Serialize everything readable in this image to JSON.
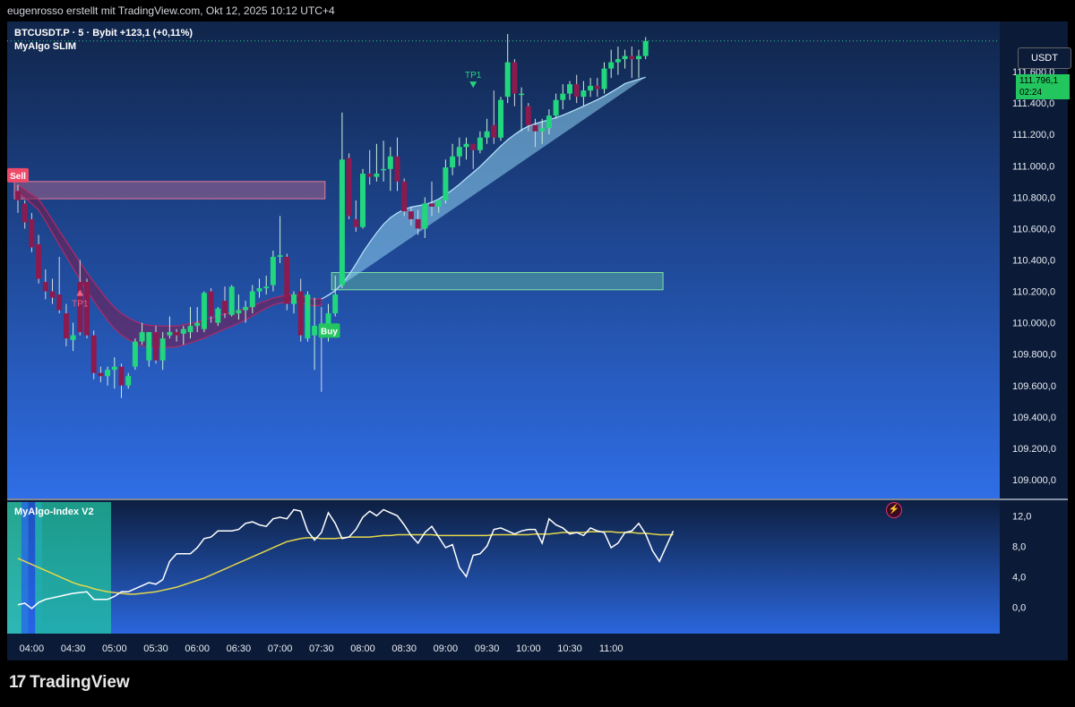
{
  "header": {
    "text": "eugenrosso erstellt mit TradingView.com, Okt 12, 2025 10:12 UTC+4"
  },
  "legend": {
    "symbol_line": "BTCUSDT.P · 5 · Bybit  +123,1 (+0,11%)",
    "indicator": "MyAlgo SLIM",
    "sub_indicator": "MyAlgo-Index V2"
  },
  "price_scale": {
    "currency": "USDT",
    "last_price": "111.796,1",
    "countdown": "02:24"
  },
  "footer": {
    "brand": "TradingView"
  },
  "signals": {
    "sell": "Sell",
    "buy": "Buy",
    "tp1_red": "TP1",
    "tp1_green": "TP1"
  },
  "colors": {
    "bull": "#22d67e",
    "bear": "#8b1a4f",
    "band_bull": "#8fd3f4",
    "band_bear": "#7a1a4a",
    "osc_line": "#ffffff",
    "signal_line": "#e6d84a"
  },
  "chart_data": [
    {
      "type": "candlestick",
      "symbol": "BTCUSDT.P",
      "interval": "5",
      "exchange": "Bybit",
      "x_ticks": [
        "04:00",
        "04:30",
        "05:00",
        "05:30",
        "06:00",
        "06:30",
        "07:00",
        "07:30",
        "08:00",
        "08:30",
        "09:00",
        "09:30",
        "10:00",
        "10:30",
        "11:00"
      ],
      "y_ticks": [
        "111.600,0",
        "111.400,0",
        "111.200,0",
        "111.000,0",
        "110.800,0",
        "110.600,0",
        "110.400,0",
        "110.200,0",
        "110.000,0",
        "109.800,0",
        "109.600,0",
        "109.400,0",
        "109.200,0",
        "109.000,0"
      ],
      "ylim": [
        108880,
        111920
      ],
      "x_start": "03:50",
      "candles": [
        [
          110840,
          110880,
          110700,
          110780
        ],
        [
          110760,
          110780,
          110600,
          110640
        ],
        [
          110660,
          110700,
          110450,
          110480
        ],
        [
          110500,
          110560,
          110250,
          110280
        ],
        [
          110260,
          110340,
          110150,
          110200
        ],
        [
          110200,
          110280,
          110120,
          110160
        ],
        [
          110180,
          110420,
          110060,
          110080
        ],
        [
          110060,
          110120,
          109850,
          109900
        ],
        [
          109890,
          110000,
          109820,
          109920
        ],
        [
          110260,
          110400,
          109920,
          109940
        ],
        [
          110260,
          110280,
          109900,
          109920
        ],
        [
          109920,
          109950,
          109640,
          109680
        ],
        [
          109680,
          109720,
          109620,
          109660
        ],
        [
          109660,
          109720,
          109600,
          109700
        ],
        [
          109700,
          109780,
          109580,
          109720
        ],
        [
          109720,
          109740,
          109520,
          109600
        ],
        [
          109600,
          109680,
          109580,
          109660
        ],
        [
          109720,
          109900,
          109700,
          109880
        ],
        [
          109880,
          110000,
          109860,
          109940
        ],
        [
          109760,
          109940,
          109720,
          109940
        ],
        [
          109940,
          109980,
          109740,
          109760
        ],
        [
          109760,
          109940,
          109700,
          109900
        ],
        [
          109920,
          110040,
          109900,
          109940
        ],
        [
          109940,
          109960,
          109880,
          109920
        ],
        [
          109930,
          109980,
          109860,
          109960
        ],
        [
          109940,
          110100,
          109900,
          109980
        ],
        [
          109980,
          110100,
          109940,
          110000
        ],
        [
          109960,
          110200,
          109940,
          110190
        ],
        [
          110200,
          110220,
          110000,
          110040
        ],
        [
          110000,
          110100,
          109980,
          110090
        ],
        [
          110140,
          110230,
          110030,
          110060
        ],
        [
          110050,
          110240,
          110040,
          110230
        ],
        [
          110060,
          110180,
          110020,
          110080
        ],
        [
          110080,
          110140,
          110000,
          110100
        ],
        [
          110100,
          110240,
          110060,
          110200
        ],
        [
          110200,
          110280,
          110160,
          110220
        ],
        [
          110220,
          110300,
          110180,
          110230
        ],
        [
          110240,
          110460,
          110200,
          110420
        ],
        [
          110420,
          110680,
          110380,
          110430
        ],
        [
          110420,
          110440,
          110080,
          110120
        ],
        [
          110120,
          110200,
          110060,
          110180
        ],
        [
          110200,
          110280,
          109880,
          109920
        ],
        [
          109900,
          110200,
          109880,
          110180
        ],
        [
          109920,
          110160,
          109700,
          109980
        ],
        [
          109980,
          110100,
          109560,
          109920
        ],
        [
          109920,
          110120,
          109880,
          110060
        ],
        [
          110060,
          110300,
          110040,
          110180
        ],
        [
          110240,
          111340,
          110220,
          111040
        ],
        [
          111050,
          111080,
          110660,
          110680
        ],
        [
          110660,
          110780,
          110580,
          110610
        ],
        [
          110610,
          110980,
          110600,
          110950
        ],
        [
          110950,
          111100,
          110880,
          110930
        ],
        [
          110930,
          111140,
          110900,
          110950
        ],
        [
          110980,
          111160,
          110900,
          110980
        ],
        [
          110980,
          111120,
          110840,
          111060
        ],
        [
          111060,
          111180,
          110840,
          110900
        ],
        [
          110900,
          110920,
          110680,
          110710
        ],
        [
          110710,
          110740,
          110620,
          110660
        ],
        [
          110660,
          110720,
          110560,
          110600
        ],
        [
          110600,
          110800,
          110540,
          110760
        ],
        [
          110760,
          110900,
          110680,
          110740
        ],
        [
          110740,
          110780,
          110700,
          110780
        ],
        [
          110780,
          111040,
          110760,
          110990
        ],
        [
          110990,
          111140,
          110940,
          111060
        ],
        [
          111060,
          111180,
          111000,
          111120
        ],
        [
          111120,
          111180,
          111040,
          111140
        ],
        [
          111140,
          111120,
          110980,
          111100
        ],
        [
          111100,
          111220,
          111080,
          111180
        ],
        [
          111180,
          111300,
          111140,
          111220
        ],
        [
          111260,
          111480,
          111140,
          111180
        ],
        [
          111180,
          111440,
          111160,
          111420
        ],
        [
          111440,
          111840,
          111400,
          111660
        ],
        [
          111660,
          111680,
          111380,
          111460
        ],
        [
          111460,
          111500,
          111220,
          111460
        ],
        [
          111380,
          111400,
          111220,
          111260
        ],
        [
          111260,
          111300,
          111120,
          111220
        ],
        [
          111220,
          111300,
          111140,
          111240
        ],
        [
          111240,
          111360,
          111200,
          111320
        ],
        [
          111320,
          111460,
          111300,
          111420
        ],
        [
          111420,
          111520,
          111360,
          111460
        ],
        [
          111460,
          111540,
          111420,
          111520
        ],
        [
          111520,
          111580,
          111400,
          111440
        ],
        [
          111440,
          111540,
          111380,
          111480
        ],
        [
          111480,
          111560,
          111440,
          111510
        ],
        [
          111510,
          111560,
          111440,
          111490
        ],
        [
          111490,
          111660,
          111460,
          111620
        ],
        [
          111620,
          111740,
          111560,
          111660
        ],
        [
          111660,
          111760,
          111580,
          111680
        ],
        [
          111680,
          111740,
          111620,
          111700
        ],
        [
          111700,
          111760,
          111560,
          111680
        ],
        [
          111680,
          111740,
          111560,
          111700
        ],
        [
          111700,
          111820,
          111680,
          111796
        ]
      ],
      "band": {
        "bear_segment": {
          "from_index": 0,
          "to_index": 44
        },
        "bull_segment": {
          "from_index": 44,
          "to_index": 93
        }
      },
      "zones": [
        {
          "type": "supply",
          "from_index": 0,
          "to_index": 44,
          "low": 110790,
          "high": 110900
        },
        {
          "type": "demand",
          "from_index": 46,
          "to_index": 93,
          "low": 110210,
          "high": 110320
        }
      ],
      "annotations": [
        {
          "label": "Sell",
          "index": 0,
          "price": 110940
        },
        {
          "label": "TP1",
          "index": 9,
          "price": 110160
        },
        {
          "label": "Buy",
          "index": 45,
          "price": 109950
        },
        {
          "label": "TP1",
          "index": 66,
          "price": 111480
        }
      ]
    },
    {
      "type": "line",
      "title": "MyAlgo-Index V2",
      "y_ticks": [
        "12,0",
        "8,0",
        "4,0",
        "0,0"
      ],
      "ylim": [
        -3.5,
        13.8
      ],
      "series": [
        {
          "values": [
            0.3,
            0.5,
            -0.2,
            0.6,
            1.0,
            1.2,
            1.4,
            1.6,
            1.8,
            1.9,
            2.0,
            1.0,
            1.0,
            1.0,
            1.4,
            2.0,
            2.0,
            2.4,
            2.8,
            3.2,
            3.0,
            3.6,
            6.0,
            7.0,
            7.0,
            7.0,
            7.8,
            9.0,
            9.2,
            10.0,
            10.0,
            10.0,
            10.2,
            11.0,
            11.2,
            10.8,
            10.6,
            11.6,
            11.8,
            11.6,
            12.8,
            12.6,
            10.0,
            8.8,
            9.8,
            12.4,
            11.0,
            9.0,
            9.2,
            10.2,
            11.8,
            12.6,
            12.0,
            12.8,
            12.4,
            12.0,
            10.8,
            9.4,
            8.4,
            9.8,
            10.6,
            9.2,
            7.8,
            8.2,
            5.2,
            4.0,
            6.8,
            7.0,
            8.0,
            10.2,
            10.4,
            10.0,
            9.6,
            10.0,
            10.2,
            10.2,
            8.4,
            11.6,
            10.8,
            10.4,
            9.6,
            9.8,
            9.4,
            10.4,
            10.0,
            9.8,
            7.8,
            8.4,
            9.8,
            10.0,
            11.0,
            9.6,
            7.4,
            6.0,
            8.0,
            10.0
          ]
        },
        {
          "values": [
            6.4,
            6.0,
            5.6,
            5.2,
            4.8,
            4.4,
            4.0,
            3.6,
            3.2,
            2.9,
            2.7,
            2.4,
            2.2,
            2.0,
            1.9,
            1.8,
            1.7,
            1.7,
            1.8,
            1.9,
            2.0,
            2.2,
            2.4,
            2.6,
            2.9,
            3.2,
            3.5,
            3.8,
            4.2,
            4.6,
            5.0,
            5.4,
            5.8,
            6.2,
            6.6,
            7.0,
            7.4,
            7.8,
            8.2,
            8.6,
            8.8,
            9.0,
            9.1,
            9.1,
            9.0,
            9.0,
            9.0,
            9.1,
            9.2,
            9.2,
            9.2,
            9.2,
            9.3,
            9.4,
            9.4,
            9.5,
            9.5,
            9.5,
            9.5,
            9.5,
            9.5,
            9.4,
            9.4,
            9.4,
            9.4,
            9.4,
            9.4,
            9.4,
            9.4,
            9.5,
            9.5,
            9.5,
            9.5,
            9.5,
            9.5,
            9.6,
            9.6,
            9.6,
            9.7,
            9.8,
            9.8,
            9.8,
            9.8,
            9.9,
            9.9,
            9.9,
            9.9,
            9.8,
            9.8,
            9.8,
            9.7,
            9.7,
            9.6,
            9.5,
            9.5,
            9.5
          ]
        }
      ],
      "histogram_segments": [
        {
          "from_index": 0,
          "to_index": 1,
          "color": "#2fd3a8"
        },
        {
          "from_index": 1,
          "to_index": 3,
          "color": "#2563eb"
        },
        {
          "from_index": 3,
          "to_index": 13,
          "color": "#22c4a0"
        }
      ]
    }
  ]
}
